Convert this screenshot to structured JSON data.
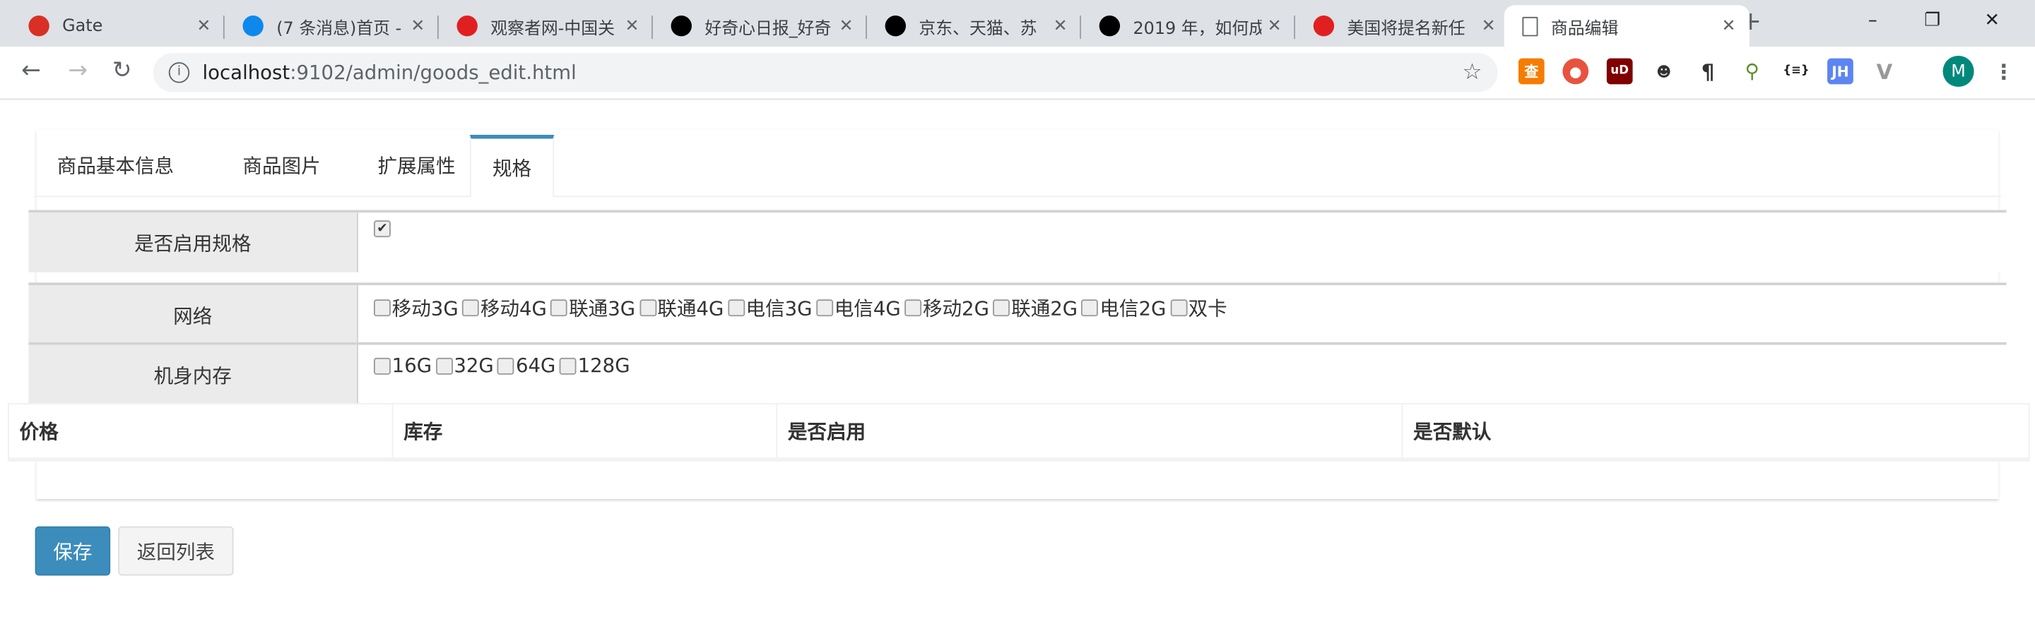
{
  "browser": {
    "tabs": [
      {
        "title": "Gate",
        "icon": "gate-favicon",
        "color": "#d93025"
      },
      {
        "title": "(7 条消息)首页 -",
        "icon": "zhihu-favicon",
        "color": "#0f88eb"
      },
      {
        "title": "观察者网-中国关",
        "icon": "guancha-favicon",
        "color": "#e02020"
      },
      {
        "title": "好奇心日报_好奇",
        "icon": "qdaily-favicon",
        "color": "#000000"
      },
      {
        "title": "京东、天猫、苏",
        "icon": "qdaily-favicon",
        "color": "#000000"
      },
      {
        "title": "2019 年，如何成",
        "icon": "qdaily-favicon",
        "color": "#000000"
      },
      {
        "title": "美国将提名新任",
        "icon": "guancha-favicon",
        "color": "#e02020"
      },
      {
        "title": "商品编辑",
        "icon": "page-icon",
        "color": "#ffffff"
      }
    ],
    "url_host": "localhost",
    "url_path": ":9102/admin/goods_edit.html",
    "profile_initial": "M",
    "ext_labels": {
      "cha": "查",
      "ub": "uD",
      "json": "{≡}",
      "jh": "JH"
    }
  },
  "page": {
    "tabs": [
      "商品基本信息",
      "商品图片",
      "扩展属性",
      "规格"
    ],
    "active_tab": 3,
    "enable_spec_label": "是否启用规格",
    "enable_spec_checked": true,
    "specs": [
      {
        "name": "网络",
        "options": [
          "移动3G",
          "移动4G",
          "联通3G",
          "联通4G",
          "电信3G",
          "电信4G",
          "移动2G",
          "联通2G",
          "电信2G",
          "双卡"
        ]
      },
      {
        "name": "机身内存",
        "options": [
          "16G",
          "32G",
          "64G",
          "128G"
        ]
      }
    ],
    "item_table_headers": [
      "价格",
      "库存",
      "是否启用",
      "是否默认"
    ],
    "save_label": "保存",
    "back_label": "返回列表",
    "accent": "#3c8dbc"
  }
}
